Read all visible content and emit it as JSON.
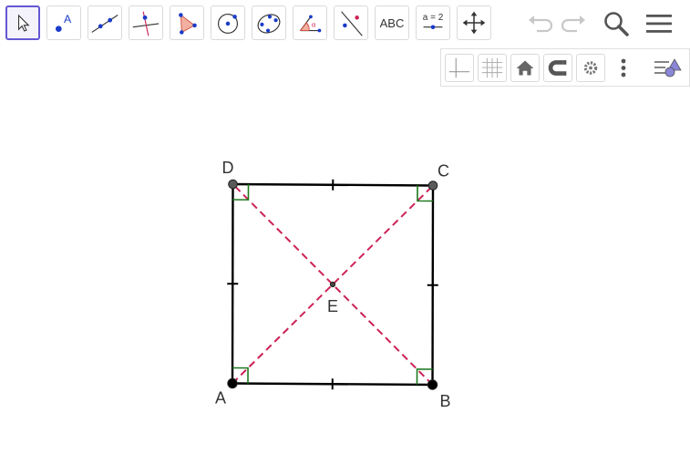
{
  "toolbar": {
    "tools": [
      {
        "name": "move",
        "selected": true
      },
      {
        "name": "point"
      },
      {
        "name": "line"
      },
      {
        "name": "perpendicular-line"
      },
      {
        "name": "polygon"
      },
      {
        "name": "circle-center-point"
      },
      {
        "name": "conic-five-points"
      },
      {
        "name": "angle"
      },
      {
        "name": "reflect"
      },
      {
        "name": "text",
        "label": "ABC"
      },
      {
        "name": "slider",
        "label": "a = 2"
      },
      {
        "name": "move-graphics-view"
      }
    ],
    "right": [
      "undo-icon",
      "redo-icon",
      "search-icon",
      "menu-icon"
    ]
  },
  "style_bar": [
    "axes-icon",
    "grid-icon",
    "home-icon",
    "snap-icon",
    "gear-icon",
    "more-icon",
    "algebra-toggle-icon"
  ],
  "construction": {
    "points": [
      {
        "label": "A",
        "x": 0,
        "y": 0
      },
      {
        "label": "B",
        "x": 1,
        "y": 0
      },
      {
        "label": "C",
        "x": 1,
        "y": 1
      },
      {
        "label": "D",
        "x": 0,
        "y": 1
      },
      {
        "label": "E",
        "x": 0.5,
        "y": 0.5
      }
    ],
    "colors": {
      "sides": "#000000",
      "diagonals": "#cc2255",
      "right_angles": "#1e7a1e",
      "points": "#333333",
      "label": "#333333"
    }
  }
}
